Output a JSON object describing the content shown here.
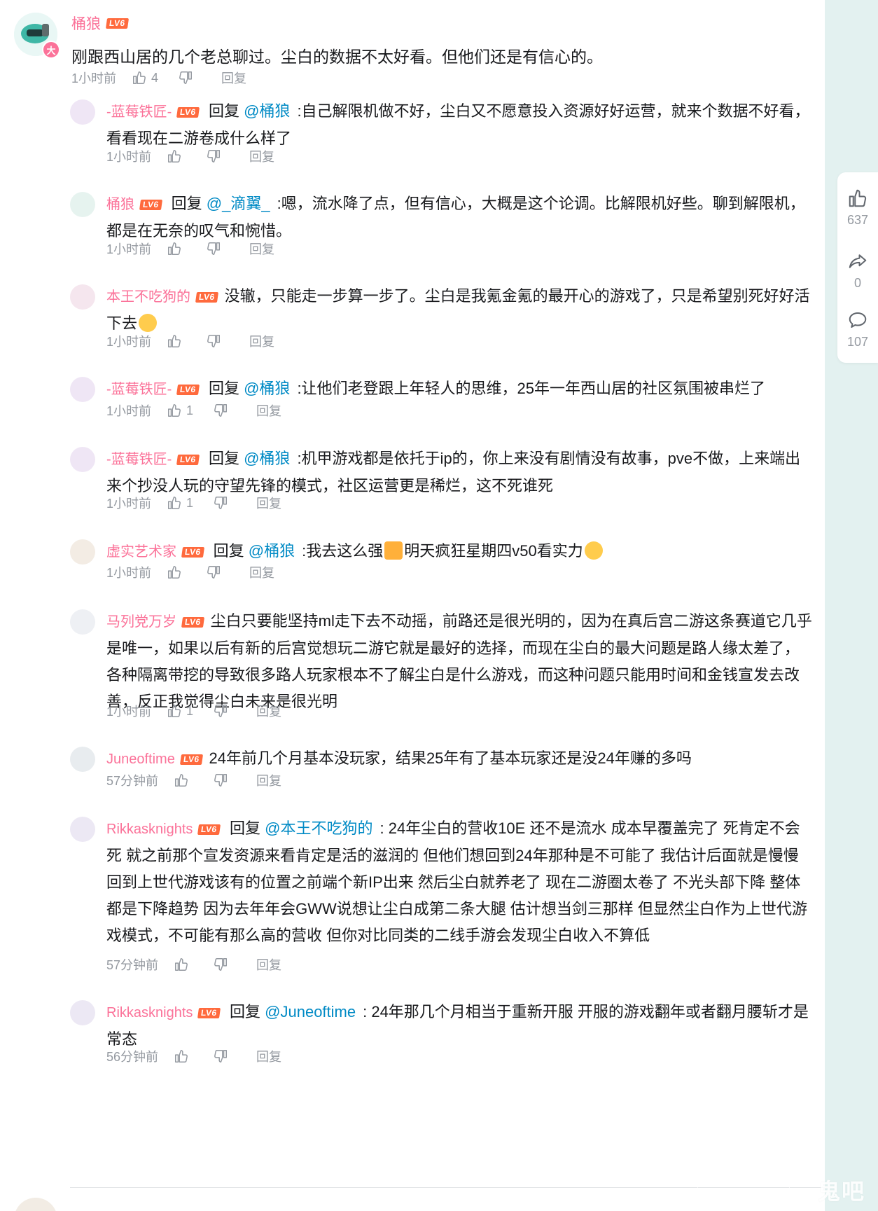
{
  "root": {
    "username": "桶狼",
    "level": "LV6",
    "badge": "大",
    "text": "刚跟西山居的几个老总聊过。尘白的数据不太好看。但他们还是有信心的。",
    "time": "1小时前",
    "likes": "4",
    "reply_label": "回复"
  },
  "replies": [
    {
      "username": "-蓝莓铁匠-",
      "level": "LV6",
      "reply_word": "回复",
      "mention": "@桶狼",
      "content": ":自己解限机做不好，尘白又不愿意投入资源好好运营，就来个数据不好看，看看现在二游卷成什么样了",
      "time": "1小时前",
      "likes": "",
      "reply_label": "回复"
    },
    {
      "username": "桶狼",
      "level": "LV6",
      "reply_word": "回复",
      "mention": "@_滴翼_",
      "content": ":嗯，流水降了点，但有信心，大概是这个论调。比解限机好些。聊到解限机，都是在无奈的叹气和惋惜。",
      "time": "1小时前",
      "likes": "",
      "reply_label": "回复"
    },
    {
      "username": "本王不吃狗的",
      "level": "LV6",
      "reply_word": "",
      "mention": "",
      "content": "没辙，只能走一步算一步了。尘白是我氪金氪的最开心的游戏了，只是希望别死好好活下去",
      "emoji_after": "crying-face-emoji",
      "time": "1小时前",
      "likes": "",
      "reply_label": "回复"
    },
    {
      "username": "-蓝莓铁匠-",
      "level": "LV6",
      "reply_word": "回复",
      "mention": "@桶狼",
      "content": ":让他们老登跟上年轻人的思维，25年一年西山居的社区氛围被串烂了",
      "time": "1小时前",
      "likes": "1",
      "reply_label": "回复"
    },
    {
      "username": "-蓝莓铁匠-",
      "level": "LV6",
      "reply_word": "回复",
      "mention": "@桶狼",
      "content": ":机甲游戏都是依托于ip的，你上来没有剧情没有故事，pve不做，上来端出来个抄没人玩的守望先锋的模式，社区运营更是稀烂，这不死谁死",
      "time": "1小时前",
      "likes": "1",
      "reply_label": "回复"
    },
    {
      "username": "虚实艺术家",
      "level": "LV6",
      "reply_word": "回复",
      "mention": "@桶狼",
      "content": ":我去这么强",
      "content2": "明天疯狂星期四v50看实力",
      "time": "1小时前",
      "likes": "",
      "reply_label": "回复"
    },
    {
      "username": "马列党万岁",
      "level": "LV6",
      "reply_word": "",
      "mention": "",
      "content": "尘白只要能坚持ml走下去不动摇，前路还是很光明的，因为在真后宫二游这条赛道它几乎是唯一，如果以后有新的后宫觉想玩二游它就是最好的选择，而现在尘白的最大问题是路人缘太差了，各种隔离带挖的导致很多路人玩家根本不了解尘白是什么游戏，而这种问题只能用时间和金钱宣发去改善，反正我觉得尘白未来是很光明",
      "time": "1小时前",
      "likes": "1",
      "reply_label": "回复"
    },
    {
      "username": "Juneoftime",
      "level": "LV6",
      "reply_word": "",
      "mention": "",
      "content": "24年前几个月基本没玩家，结果25年有了基本玩家还是没24年赚的多吗",
      "time": "57分钟前",
      "likes": "",
      "reply_label": "回复"
    },
    {
      "username": "Rikkasknights",
      "level": "LV6",
      "reply_word": "回复",
      "mention": "@本王不吃狗的",
      "content": ": 24年尘白的营收10E 还不是流水 成本早覆盖完了 死肯定不会死 就之前那个宣发资源来看肯定是活的滋润的 但他们想回到24年那种是不可能了 我估计后面就是慢慢回到上世代游戏该有的位置之前端个新IP出来 然后尘白就养老了 现在二游圈太卷了 不光头部下降 整体都是下降趋势 因为去年年会GWW说想让尘白成第二条大腿 估计想当剑三那样 但显然尘白作为上世代游戏模式，不可能有那么高的营收 但你对比同类的二线手游会发现尘白收入不算低",
      "time": "57分钟前",
      "likes": "",
      "reply_label": "回复"
    },
    {
      "username": "Rikkasknights",
      "level": "LV6",
      "reply_word": "回复",
      "mention": "@Juneoftime",
      "content": ": 24年那几个月相当于重新开服 开服的游戏翻年或者翻月腰斩才是常态",
      "time": "56分钟前",
      "likes": "",
      "reply_label": "回复"
    }
  ],
  "side": {
    "likes": "637",
    "shares": "0",
    "comments": "107"
  },
  "watermark": "鬼吧",
  "colors": {
    "username": "#fb7299",
    "mention": "#008ac5",
    "meta": "#9499a0",
    "side_bg": "#e3f1f0",
    "level": "#ff6a3d"
  }
}
